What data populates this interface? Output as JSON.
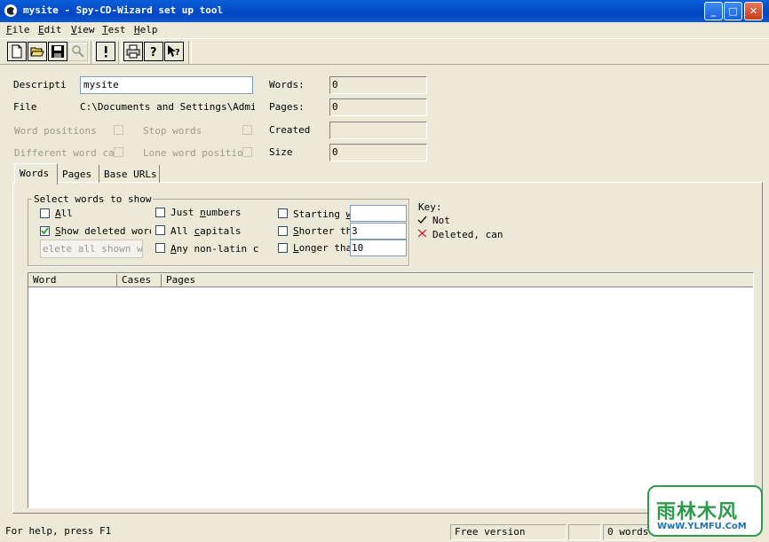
{
  "window": {
    "title": "mysite - Spy-CD-Wizard set up tool"
  },
  "menu": {
    "file": {
      "u": "F",
      "rest": "ile"
    },
    "edit": {
      "u": "E",
      "rest": "dit"
    },
    "view": {
      "u": "V",
      "rest": "iew"
    },
    "test": {
      "u": "T",
      "rest": "est"
    },
    "help": {
      "u": "H",
      "rest": "elp"
    }
  },
  "toolbar": {
    "icons": [
      "new-icon",
      "open-icon",
      "save-icon",
      "find-icon",
      "exclamation-icon",
      "print-icon",
      "help-icon",
      "context-help-icon"
    ]
  },
  "form": {
    "description_label": "Descriptio",
    "description_value": "mysite",
    "file_label": "File",
    "file_value": "C:\\Documents and Settings\\Adminis",
    "word_positions_label": "Word positions",
    "stop_words_label": "Stop words",
    "different_word_case_label": "Different word cas",
    "lone_word_positions_label": "Lone word positions",
    "words_label": "Words:",
    "words_value": "0",
    "pages_label": "Pages:",
    "pages_value": "0",
    "created_label": "Created",
    "created_value": "",
    "size_label": "Size",
    "size_value": "0"
  },
  "tabs": [
    "Words",
    "Pages",
    "Base URLs"
  ],
  "words_tab": {
    "group_title": "Select words to show",
    "all": {
      "u": "A",
      "rest": "ll"
    },
    "show_deleted": {
      "u": "S",
      "rest": "how deleted words",
      "checked": true
    },
    "delete_button": "elete all shown word",
    "just_numbers": {
      "pre": "Just ",
      "u": "n",
      "rest": "umbers"
    },
    "all_capitals": {
      "pre": "All ",
      "u": "c",
      "rest": "apitals"
    },
    "any_non_latin": {
      "u": "A",
      "rest": "ny non-latin ch"
    },
    "starting_with": {
      "pre": "Starting ",
      "u": "w",
      "rest": ""
    },
    "starting_with_value": "",
    "shorter_than": {
      "u": "S",
      "rest": "horter tha"
    },
    "shorter_than_value": "3",
    "longer_than": {
      "u": "L",
      "rest": "onger than"
    },
    "longer_than_value": "10"
  },
  "key": {
    "title": "Key:",
    "not_label": "Not",
    "deleted_label": "Deleted, can",
    "not_color": "#000000",
    "deleted_color": "#E0202A"
  },
  "list": {
    "columns": [
      "Word",
      "Cases",
      "Pages"
    ]
  },
  "status": {
    "help": "For help, press F1",
    "version": "Free version",
    "words": "0 words"
  },
  "watermark": {
    "title": "雨林木风",
    "url": "WwW.YLMFU.CoM"
  }
}
